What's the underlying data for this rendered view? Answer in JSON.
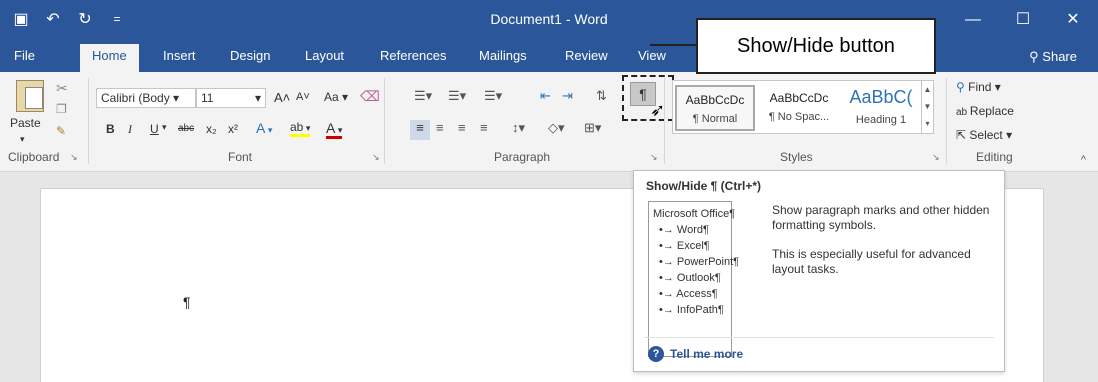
{
  "window": {
    "title": "Document1  -  Word",
    "controls": {
      "minimize": "—",
      "restore": "☐",
      "close": "✕"
    }
  },
  "qat": {
    "save_icon": "save-icon",
    "undo_icon": "undo-icon",
    "redo_icon": "redo-icon",
    "customize_icon": "customize-qat-icon"
  },
  "tabs": {
    "file": "File",
    "home": "Home",
    "insert": "Insert",
    "design": "Design",
    "layout": "Layout",
    "references": "References",
    "mailings": "Mailings",
    "review": "Review",
    "view": "View",
    "share": "Share"
  },
  "clipboard": {
    "paste_label": "Paste",
    "group_label": "Clipboard"
  },
  "font": {
    "name": "Calibri (Body",
    "size": "11",
    "grow": "A",
    "shrink": "A",
    "case": "Aa",
    "bold": "B",
    "italic": "I",
    "underline": "U",
    "strike": "abc",
    "subscript": "x₂",
    "superscript": "x²",
    "effects": "A",
    "highlight": "ab",
    "color": "A",
    "group_label": "Font"
  },
  "paragraph": {
    "show_hide_glyph": "¶",
    "group_label": "Paragraph"
  },
  "styles": {
    "items": [
      {
        "sample": "AaBbCcDc",
        "name": "¶ Normal"
      },
      {
        "sample": "AaBbCcDc",
        "name": "¶ No Spac..."
      },
      {
        "sample": "AaBbC(",
        "name": "Heading 1"
      }
    ],
    "group_label": "Styles"
  },
  "editing": {
    "find": "Find",
    "replace": "Replace",
    "select": "Select",
    "group_label": "Editing"
  },
  "callout": {
    "label": "Show/Hide button"
  },
  "document": {
    "paragraph_mark": "¶"
  },
  "tooltip": {
    "title": "Show/Hide ¶ (Ctrl+*)",
    "preview_root": "Microsoft Office¶",
    "preview_items": [
      "•→ Word¶",
      "•→ Excel¶",
      "•→ PowerPoint¶",
      "•→ Outlook¶",
      "•→ Access¶",
      "•→ InfoPath¶"
    ],
    "desc1": "Show paragraph marks and other hidden formatting symbols.",
    "desc2": "This is especially useful for advanced layout tasks.",
    "more": "Tell me more"
  },
  "colors": {
    "brand": "#2b579a",
    "ribbon": "#f3f3f3",
    "canvas": "#e6e6e6"
  }
}
